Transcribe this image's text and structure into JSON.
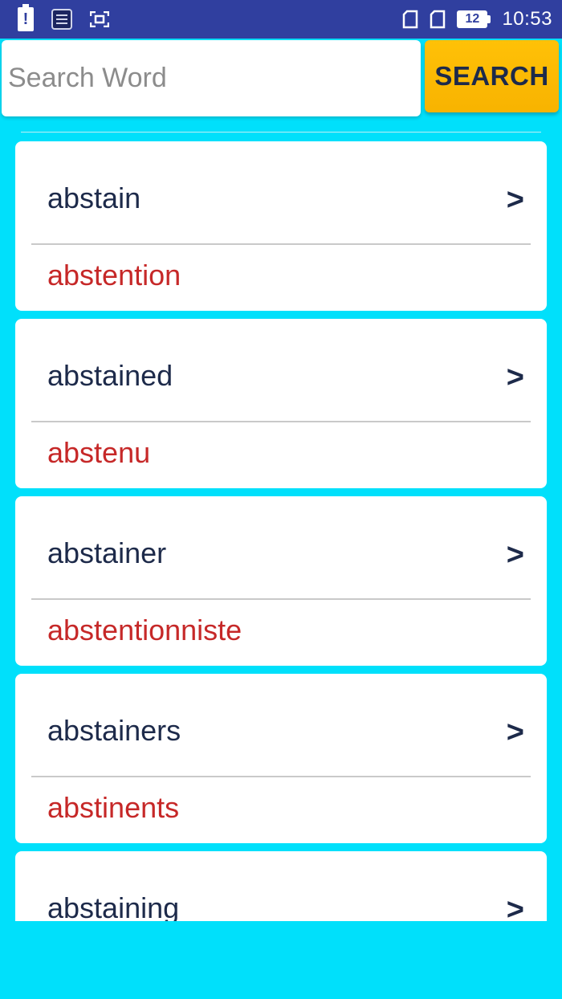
{
  "status_bar": {
    "battery_level": "12",
    "time": "10:53",
    "icons": [
      "battery-alert-icon",
      "list-icon",
      "screenshot-icon",
      "sim-icon",
      "sim-icon",
      "battery-icon"
    ]
  },
  "search": {
    "placeholder": "Search Word",
    "button_label": "SEARCH"
  },
  "colors": {
    "background": "#00e0fb",
    "status_bar": "#303f9f",
    "button": "#ffc107",
    "word_text": "#1d2a4a",
    "translation_text": "#c62828"
  },
  "results": [
    {
      "word": "abstain",
      "translation": "abstention",
      "chevron": ">"
    },
    {
      "word": "abstained",
      "translation": "abstenu",
      "chevron": ">"
    },
    {
      "word": "abstainer",
      "translation": "abstentionniste",
      "chevron": ">"
    },
    {
      "word": "abstainers",
      "translation": "abstinents",
      "chevron": ">"
    },
    {
      "word": "abstaining",
      "translation": "",
      "chevron": ">"
    }
  ]
}
